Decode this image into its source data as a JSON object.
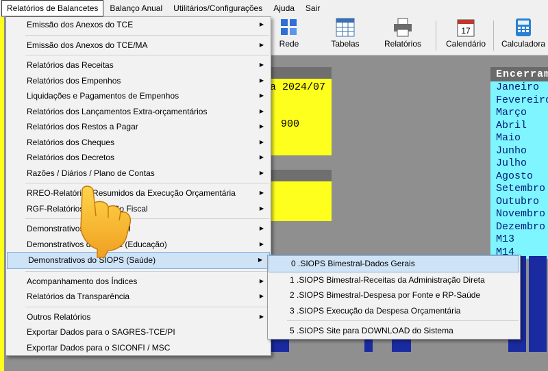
{
  "menubar": {
    "items": [
      "Relatórios de Balancetes",
      "Balanço Anual",
      "Utilitários/Configurações",
      "Ajuda",
      "Sair"
    ]
  },
  "toolbar": {
    "buttons": [
      {
        "label": "Rede",
        "icon": "network-icon"
      },
      {
        "label": "Tabelas",
        "icon": "table-icon"
      },
      {
        "label": "Relatórios",
        "icon": "printer-icon"
      },
      {
        "label": "Calendário",
        "icon": "calendar-icon"
      },
      {
        "label": "Calculadora",
        "icon": "calculator-icon"
      }
    ],
    "calendar_day": "17"
  },
  "panel_top": {
    "line1": "a 2024/07",
    "line2": "900"
  },
  "months": {
    "header": "Encerram",
    "items": [
      "Janeiro",
      "Fevereiro",
      "Março",
      "Abril",
      "Maio",
      "Junho",
      "Julho",
      "Agosto",
      "Setembro",
      "Outubro",
      "Novembro",
      "Dezembro",
      "M13",
      "M14"
    ]
  },
  "main_menu": {
    "items": [
      "Emissão dos Anexos do TCE",
      "Emissão dos Anexos do TCE/MA",
      "Relatórios das Receitas",
      "Relatórios dos Empenhos",
      "Liquidações e Pagamentos de Empenhos",
      "Relatórios dos Lançamentos Extra-orçamentários",
      "Relatórios dos Restos a Pagar",
      "Relatórios dos Cheques",
      "Relatórios dos Decretos",
      "Razões / Diários / Plano de Contas",
      "RREO-Relatórios Resumidos da Execução Orçamentária",
      "RGF-Relatórios da Gestão Fiscal",
      "Demonstrativos do SICONFI",
      "Demonstrativos do SIOPE (Educação)",
      "Demonstrativos do SIOPS (Saúde)",
      "Acompanhamento dos Índices",
      "Relatórios da Transparência",
      "Outros Relatórios",
      "Exportar Dados para o SAGRES-TCE/PI",
      "Exportar Dados para o SICONFI / MSC"
    ]
  },
  "siops_menu": {
    "items": [
      "0 .SIOPS Bimestral-Dados Gerais",
      "1 .SIOPS Bimestral-Receitas da Administração Direta",
      "2 .SIOPS Bimestral-Despesa por Fonte e RP-Saúde",
      "3 .SIOPS Execução da Despesa Orçamentária",
      "5 .SIOPS Site para DOWNLOAD do Sistema"
    ]
  },
  "colors": {
    "highlight": "#cfe3f7",
    "yellow_panel": "#ffff1e",
    "cyan_list": "#7ff5ff",
    "bar_blue": "#1a2aa0"
  }
}
